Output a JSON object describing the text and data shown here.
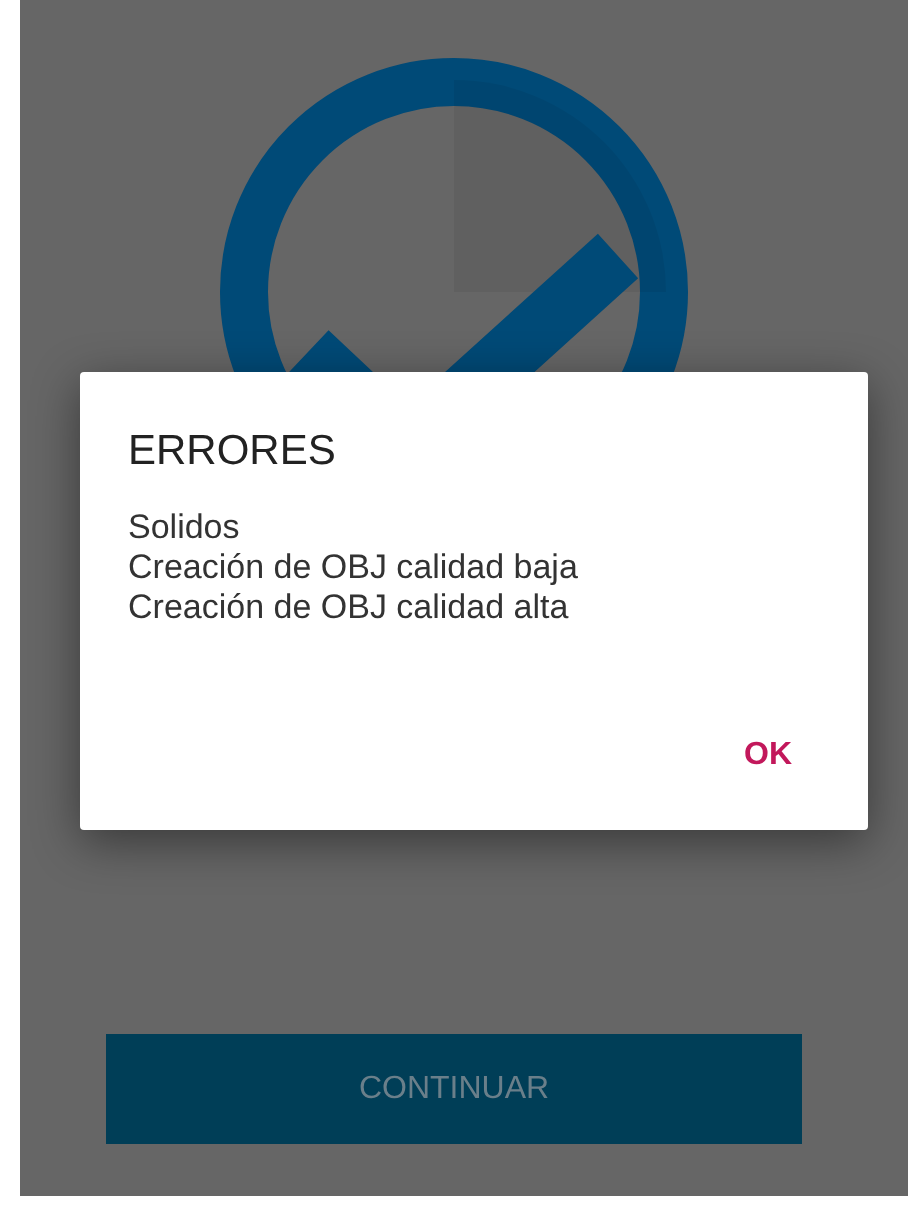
{
  "dialog": {
    "title": "ERRORES",
    "lines": [
      "Solidos",
      "Creación de OBJ calidad baja",
      "Creación de OBJ calidad alta"
    ],
    "button": "OK"
  },
  "continue_button": {
    "label": "CONTINUAR"
  }
}
